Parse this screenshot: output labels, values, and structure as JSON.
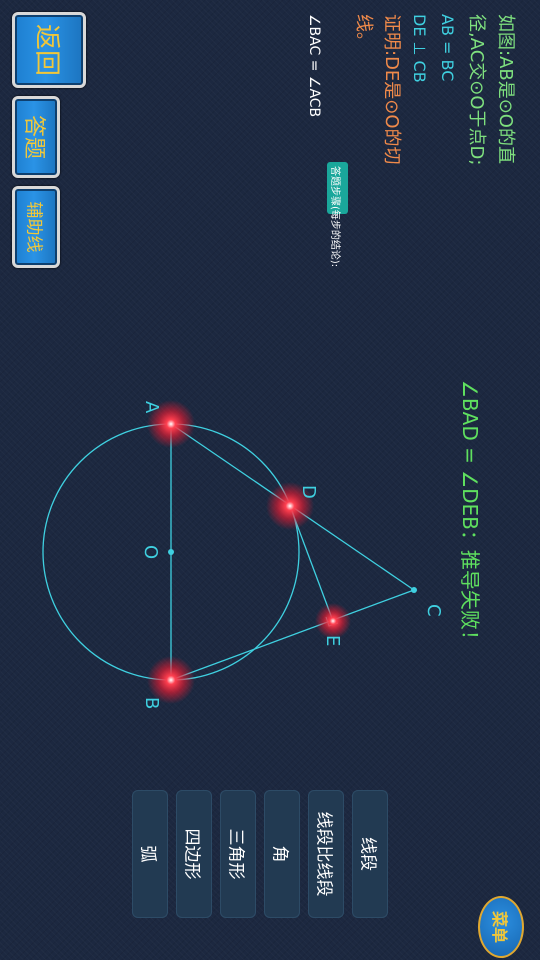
{
  "side_buttons": {
    "back": "返回",
    "answer": "答题",
    "aux_line": "辅助线"
  },
  "problem": {
    "line1": "如图:AB是⊙O的直",
    "line2": "径,AC交⊙O于点D;",
    "line3": "AB = BC",
    "line4": "DE ⊥ CB",
    "line5": "证明:DE是⊙O的切",
    "line6": "线。"
  },
  "hint": {
    "badge": "答题步骤(每步的结论):",
    "step1": "∠BAC = ∠ACB"
  },
  "feedback": "∠BAD = ∠DEB：推导失败！",
  "labels": {
    "A": "A",
    "B": "B",
    "C": "C",
    "D": "D",
    "E": "E",
    "O": "O"
  },
  "menu": {
    "items": [
      "线段",
      "线段比线段",
      "角",
      "三角形",
      "四边形",
      "弧"
    ],
    "menu_button": "菜单"
  },
  "colors": {
    "accent_cyan": "#3fd0e0",
    "problem_green": "#7ee07e",
    "proof_orange": "#f08a4a",
    "feedback_green": "#5fe05f",
    "button_gold": "#f0c73a",
    "point_red": "#ff2a3a"
  }
}
